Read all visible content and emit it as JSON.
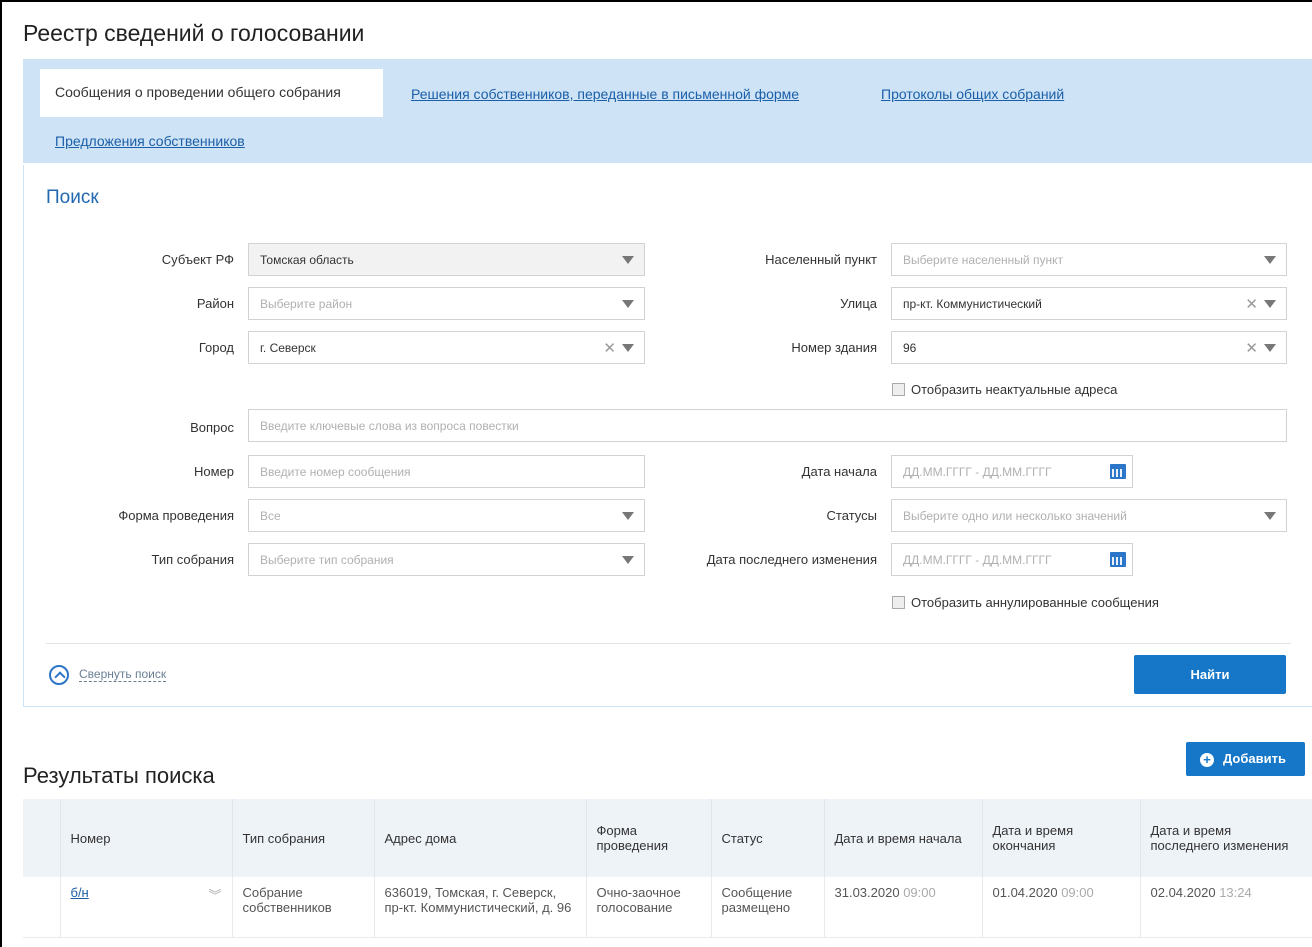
{
  "page_title": "Реестр сведений о голосовании",
  "tabs": {
    "active": "Сообщения о проведении общего собрания",
    "decisions": "Решения собственников, переданные в письменной форме",
    "protocols": "Протоколы общих собраний",
    "proposals": "Предложения собственников"
  },
  "search": {
    "title": "Поиск",
    "subject_label": "Субъект РФ",
    "subject_value": "Томская область",
    "district_label": "Район",
    "district_placeholder": "Выберите район",
    "city_label": "Город",
    "city_value": "г. Северск",
    "settlement_label": "Населенный пункт",
    "settlement_placeholder": "Выберите населенный пункт",
    "street_label": "Улица",
    "street_value": "пр-кт. Коммунистический",
    "building_label": "Номер здания",
    "building_value": "96",
    "show_inactive_label": "Отобразить неактуальные адреса",
    "question_label": "Вопрос",
    "question_placeholder": "Введите ключевые слова из вопроса повестки",
    "number_label": "Номер",
    "number_placeholder": "Введите номер сообщения",
    "form_label": "Форма проведения",
    "form_value": "Все",
    "type_label": "Тип собрания",
    "type_placeholder": "Выберите тип собрания",
    "start_date_label": "Дата начала",
    "start_date_placeholder": "ДД.ММ.ГГГГ - ДД.ММ.ГГГГ",
    "statuses_label": "Статусы",
    "statuses_placeholder": "Выберите одно или несколько значений",
    "modified_label": "Дата последнего изменения",
    "modified_placeholder": "ДД.ММ.ГГГГ - ДД.ММ.ГГГГ",
    "show_cancelled_label": "Отобразить аннулированные сообщения",
    "collapse_label": "Свернуть поиск",
    "find_button": "Найти"
  },
  "results": {
    "title": "Результаты поиска",
    "add_button": "Добавить",
    "columns": [
      "Номер",
      "Тип собрания",
      "Адрес дома",
      "Форма проведения",
      "Статус",
      "Дата и время начала",
      "Дата и время окончания",
      "Дата и время последнего изменения"
    ],
    "rows": [
      {
        "number": "б/н",
        "type": "Собрание собственников",
        "address": "636019, Томская, г. Северск, пр-кт. Коммунистический, д. 96",
        "form": "Очно-заочное голосование",
        "status": "Сообщение размещено",
        "start_date": "31.03.2020",
        "start_time": "09:00",
        "end_date": "01.04.2020",
        "end_time": "09:00",
        "modified_date": "02.04.2020",
        "modified_time": "13:24"
      }
    ]
  }
}
